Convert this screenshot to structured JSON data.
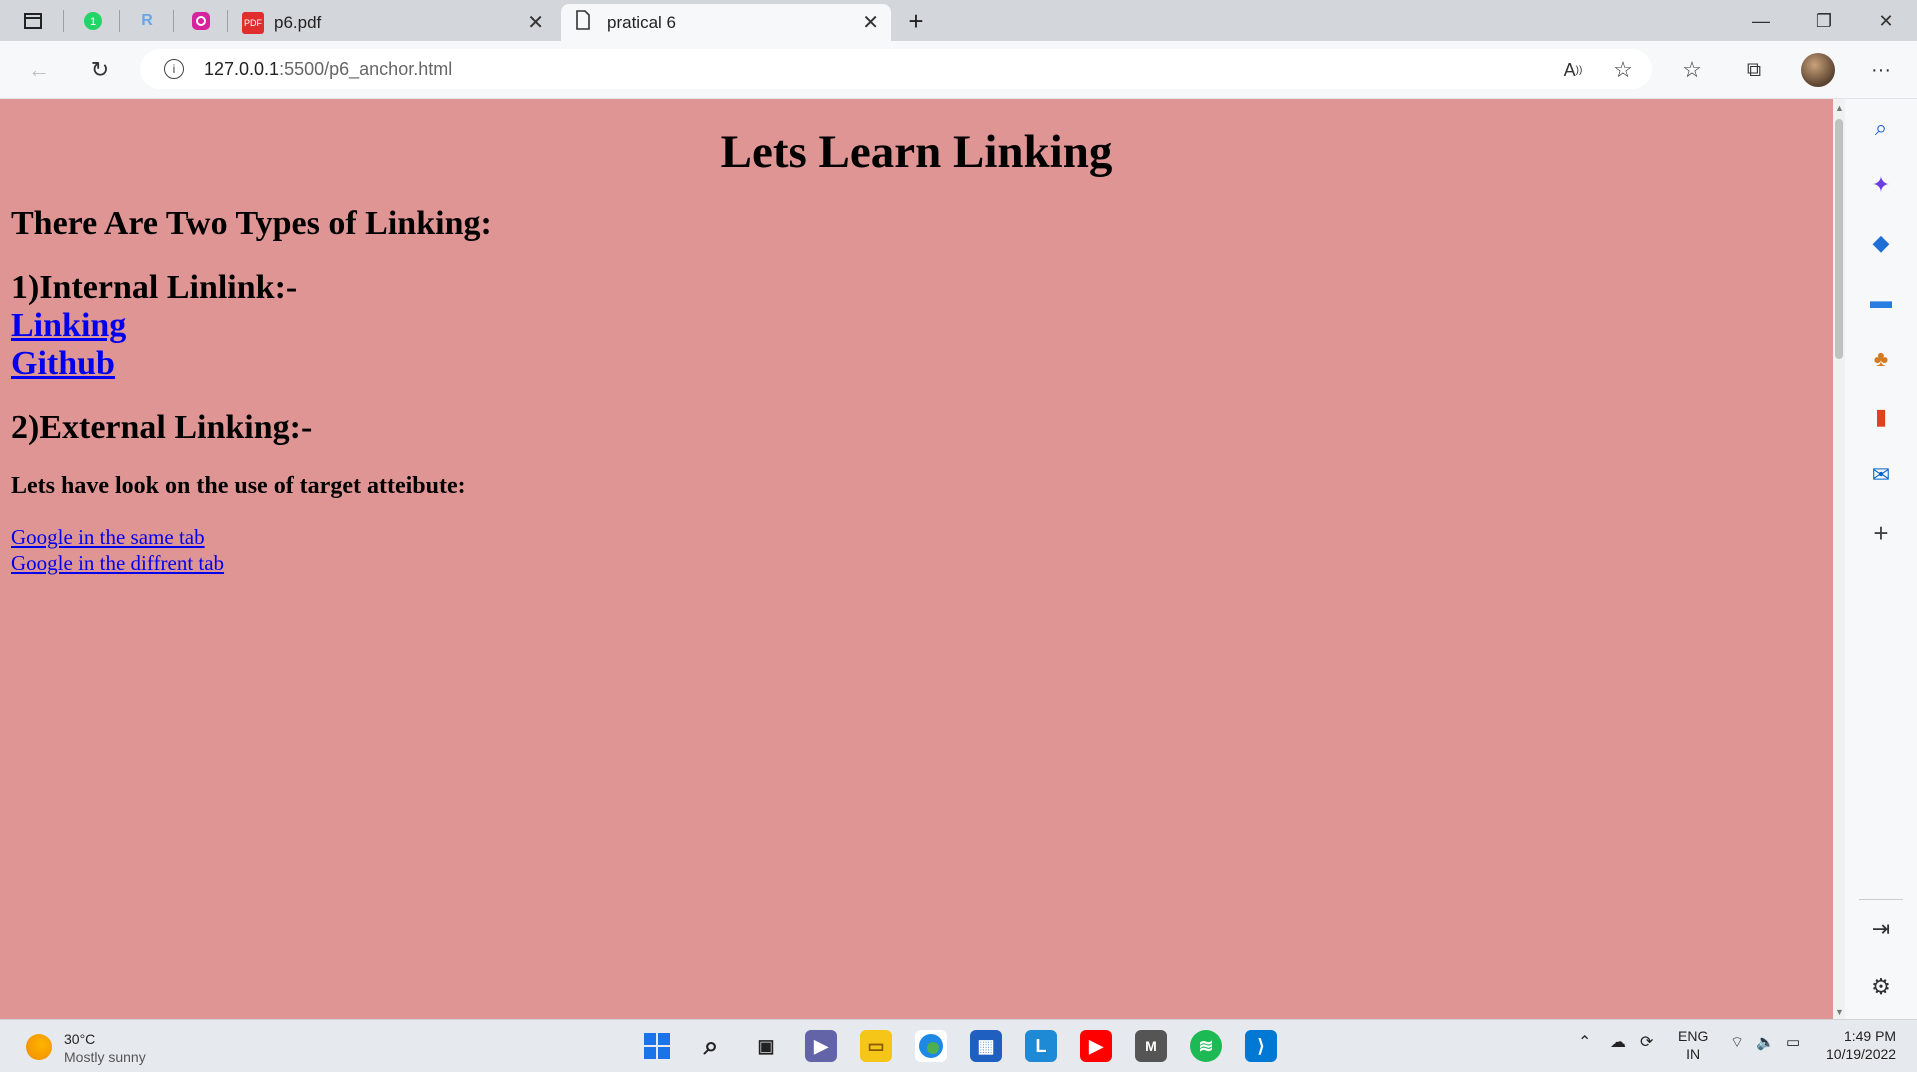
{
  "browser": {
    "tabs": [
      {
        "label": "p6.pdf",
        "icon": "pdf-icon"
      },
      {
        "label": "pratical 6",
        "icon": "page-icon"
      }
    ],
    "url_host": "127.0.0.1",
    "url_rest": ":5500/p6_anchor.html"
  },
  "page": {
    "title": "Lets Learn Linking",
    "intro": "There Are Two Types of Linking:",
    "internal_heading": "1)Internal Linlink:-",
    "internal_links": [
      "Linking",
      "Github"
    ],
    "external_heading": "2)External Linking:-",
    "target_heading": "Lets have look on the use of target atteibute:",
    "external_links": [
      "Google in the same tab",
      "Google in the diffrent tab"
    ],
    "background_color": "#e09595",
    "link_color": "#0000ee"
  },
  "taskbar": {
    "weather_temp": "30°C",
    "weather_desc": "Mostly sunny",
    "lang_line1": "ENG",
    "lang_line2": "IN",
    "time": "1:49 PM",
    "date": "10/19/2022"
  }
}
